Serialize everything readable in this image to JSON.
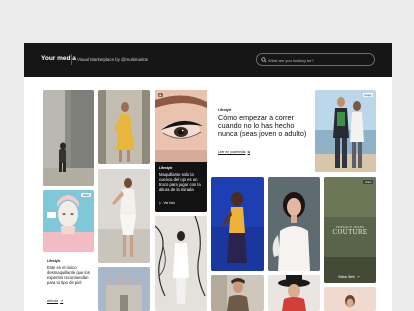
{
  "header": {
    "logo": "Your media",
    "tagline": "Visual Marketplace by @multimarkts",
    "search_placeholder": "What are you looking for?"
  },
  "tiles": {
    "badge_video": "Video",
    "badge_image": "Image"
  },
  "makeup_card": {
    "section": "Lifestyle",
    "title": "Maquillarse solo la cuenca del ojo es un truco para jugar con la altura de la mirada",
    "link": "Ver foto"
  },
  "feature_article": {
    "section": "Lifestyle",
    "title": "Cómo empezar a correr cuando no lo has hecho nunca (seas joven o adulto)",
    "link": "Leer en yourmedia"
  },
  "small_article": {
    "section": "Lifestyle",
    "title": "Este es el único desmaquillante que los expertos recomiendan para tu tipo de piel",
    "link": "Artículo"
  },
  "versace_card": {
    "brand_line_1": "VERSACE JEANS",
    "brand_line_2": "COUTURE",
    "link": "Visitar Web"
  },
  "colors": {
    "topbar": "#161616",
    "accent": "#ffffff",
    "page": "#ececec"
  },
  "icons": [
    "search-icon",
    "play-icon",
    "external-link-icon",
    "arrow-icon"
  ]
}
